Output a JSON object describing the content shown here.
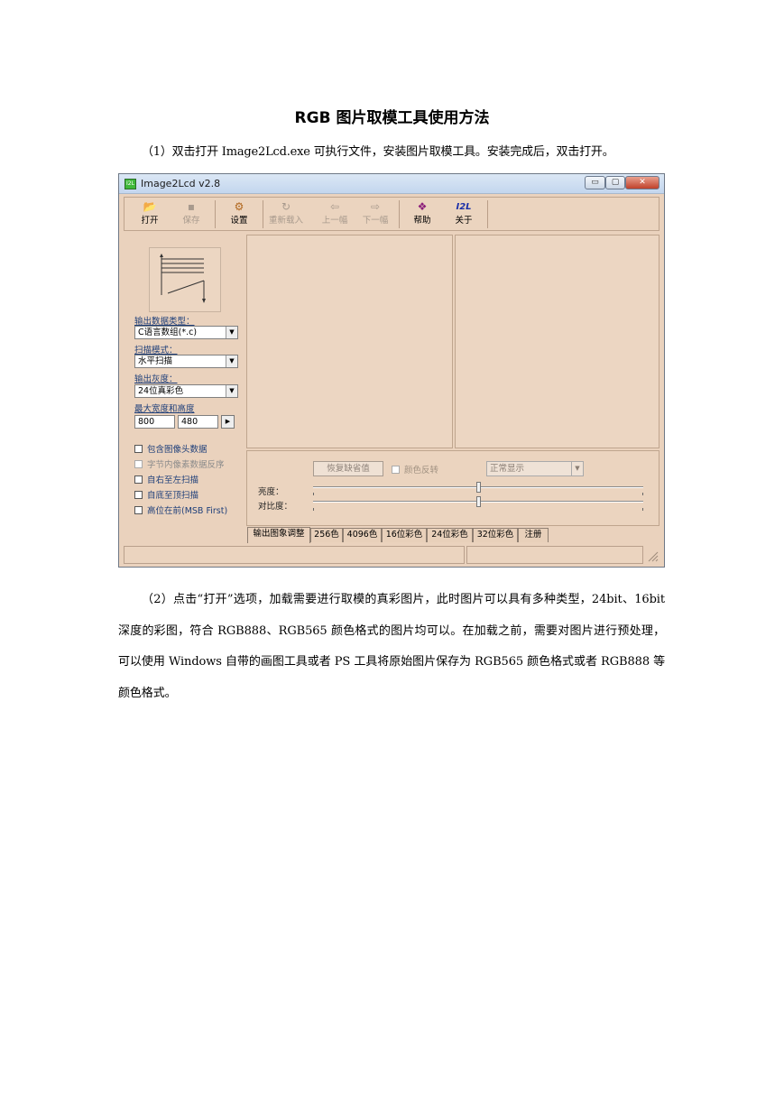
{
  "document": {
    "title": "RGB 图片取模工具使用方法",
    "step1": "（1）双击打开 Image2Lcd.exe 可执行文件，安装图片取模工具。安装完成后，双击打开。",
    "step2": "（2）点击“打开”选项，加载需要进行取模的真彩图片，此时图片可以具有多种类型，24bit、16bit 深度的彩图，符合 RGB888、RGB565 颜色格式的图片均可以。在加载之前，需要对图片进行预处理，可以使用 Windows 自带的画图工具或者 PS 工具将原始图片保存为 RGB565 颜色格式或者 RGB888 等颜色格式。"
  },
  "window": {
    "icon_text": "I2L",
    "title": "Image2Lcd v2.8",
    "min_glyph": "▭",
    "max_glyph": "▢",
    "close_glyph": "✕"
  },
  "toolbar": {
    "items": [
      {
        "label": "打开",
        "icon": "📂"
      },
      {
        "label": "保存",
        "icon": "▪"
      },
      {
        "label": "设置",
        "icon": "⚙"
      },
      {
        "label": "重新载入",
        "icon": "↻"
      },
      {
        "label": "上一幅",
        "icon": "⇦"
      },
      {
        "label": "下一幅",
        "icon": "⇨"
      },
      {
        "label": "帮助",
        "icon": "❖"
      },
      {
        "label": "关于",
        "icon": "I2L"
      }
    ]
  },
  "settings": {
    "output_type_label": "输出数据类型：",
    "output_type_value": "C语言数组(*.c)",
    "scan_mode_label": "扫描模式：",
    "scan_mode_value": "水平扫描",
    "gray_label": "输出灰度：",
    "gray_value": "24位真彩色",
    "size_label": "最大宽度和高度",
    "max_width": "800",
    "max_height": "480",
    "arrow_down": "▼",
    "arrow_right": "▶",
    "checkboxes": [
      "包含图像头数据",
      "字节内像素数据反序",
      "自右至左扫描",
      "自底至顶扫描",
      "高位在前(MSB First)"
    ]
  },
  "adjust": {
    "restore_button": "恢复缺省值",
    "invert_label": "颜色反转",
    "display_value": "正常显示",
    "brightness_label": "亮度：",
    "contrast_label": "对比度：",
    "brightness_level": 0.5,
    "contrast_level": 0.5
  },
  "tabs": [
    "输出图象调整",
    "256色",
    "4096色",
    "16位彩色",
    "24位彩色",
    "32位彩色",
    "注册"
  ]
}
